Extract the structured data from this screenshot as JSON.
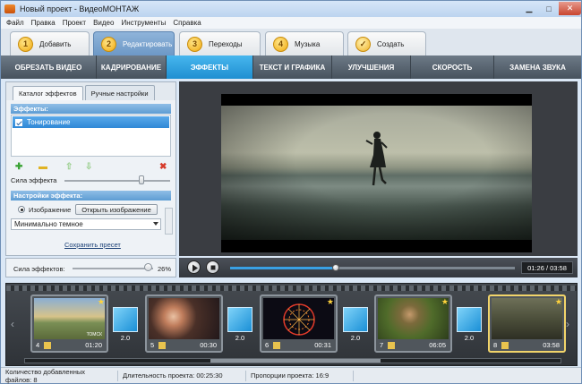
{
  "window": {
    "title": "Новый проект - ВидеоМОНТАЖ"
  },
  "menu": [
    "Файл",
    "Правка",
    "Проект",
    "Видео",
    "Инструменты",
    "Справка"
  ],
  "steps": [
    {
      "num": "1",
      "label": "Добавить"
    },
    {
      "num": "2",
      "label": "Редактировать"
    },
    {
      "num": "3",
      "label": "Переходы"
    },
    {
      "num": "4",
      "label": "Музыка"
    },
    {
      "num": "✓",
      "label": "Создать"
    }
  ],
  "edit_tabs": [
    "ОБРЕЗАТЬ ВИДЕО",
    "КАДРИРОВАНИЕ",
    "ЭФФЕКТЫ",
    "ТЕКСТ И ГРАФИКА",
    "УЛУЧШЕНИЯ",
    "СКОРОСТЬ",
    "ЗАМЕНА ЗВУКА"
  ],
  "left": {
    "subtabs": [
      "Каталог эффектов",
      "Ручные настройки"
    ],
    "effects_header": "Эффекты:",
    "effect_item": "Тонирование",
    "strength_label": "Сила эффекта",
    "settings_header": "Настройки эффекта:",
    "image_label": "Изображение",
    "open_image": "Открыть изображение",
    "combo_value": "Минимально темное",
    "save_preset": "Сохранить пресет"
  },
  "effects_strength": {
    "label": "Сила эффектов:",
    "value": "26%",
    "level": 0.93
  },
  "player": {
    "timecode": "01:26 / 03:58",
    "progress": 0.37
  },
  "clips": [
    {
      "idx": "4",
      "duration": "01:20",
      "selected": false
    },
    {
      "idx": "5",
      "duration": "00:30",
      "selected": false
    },
    {
      "idx": "6",
      "duration": "00:31",
      "selected": false
    },
    {
      "idx": "7",
      "duration": "06:05",
      "selected": false
    },
    {
      "idx": "8",
      "duration": "03:58",
      "selected": true
    }
  ],
  "transitions": [
    "2.0",
    "2.0",
    "2.0",
    "2.0"
  ],
  "thumb_text": "ТОМСК",
  "status": {
    "files": "Количество добавленных файлов: 8",
    "duration": "Длительность проекта:  00:25:30",
    "ratio": "Пропорции проекта:  16:9"
  },
  "colors": {
    "accent": "#2f9be0",
    "selected_clip": "#f1d46a",
    "star": "#ffd33c"
  }
}
